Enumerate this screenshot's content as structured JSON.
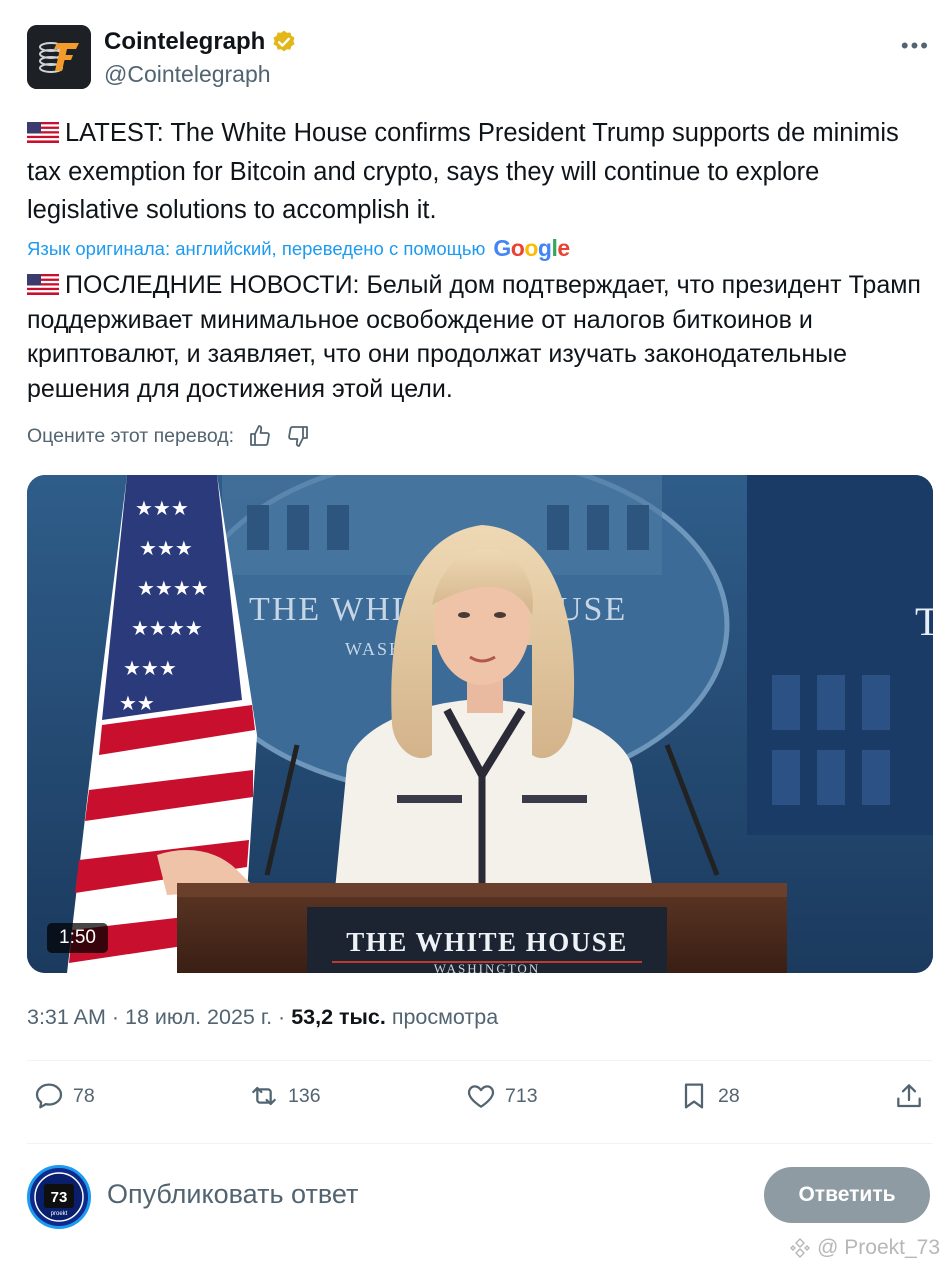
{
  "header": {
    "author_name": "Cointelegraph",
    "handle": "@Cointelegraph",
    "more_label": "•••",
    "verified_color": "#e2b719"
  },
  "tweet": {
    "flag_icon": "us-flag-icon",
    "text": "LATEST: The White House confirms President Trump supports de minimis tax exemption for Bitcoin and crypto, says they will continue to explore legislative solutions to accomplish it."
  },
  "translation": {
    "note": "Язык оригинала: английский, переведено с помощью",
    "provider": "Google",
    "text": "ПОСЛЕДНИЕ НОВОСТИ: Белый дом подтверждает, что президент Трамп поддерживает минимальное освобождение от налогов биткоинов и криптовалют, и заявляет, что они продолжат изучать законодательные решения для достижения этой цели.",
    "rate_label": "Оцените этот перевод:"
  },
  "media": {
    "duration": "1:50",
    "podium_text": "THE WHITE HOUSE",
    "podium_subtext": "WASHINGTON",
    "backdrop_text": "THE WHITE HOUSE",
    "backdrop_subtext": "WASH"
  },
  "meta": {
    "time": "3:31 AM",
    "date": "18 июл. 2025 г.",
    "views_count": "53,2 тыс.",
    "views_label": "просмотра"
  },
  "actions": {
    "replies": "78",
    "reposts": "136",
    "likes": "713",
    "bookmarks": "28"
  },
  "reply_box": {
    "placeholder": "Опубликовать ответ",
    "button_label": "Ответить",
    "avatar_text": "73",
    "avatar_subtext": "proekt"
  },
  "watermark": "@ Proekt_73",
  "colors": {
    "accent": "#1d9bf0",
    "secondary_text": "#536471",
    "reply_button": "#8f9ba3"
  }
}
